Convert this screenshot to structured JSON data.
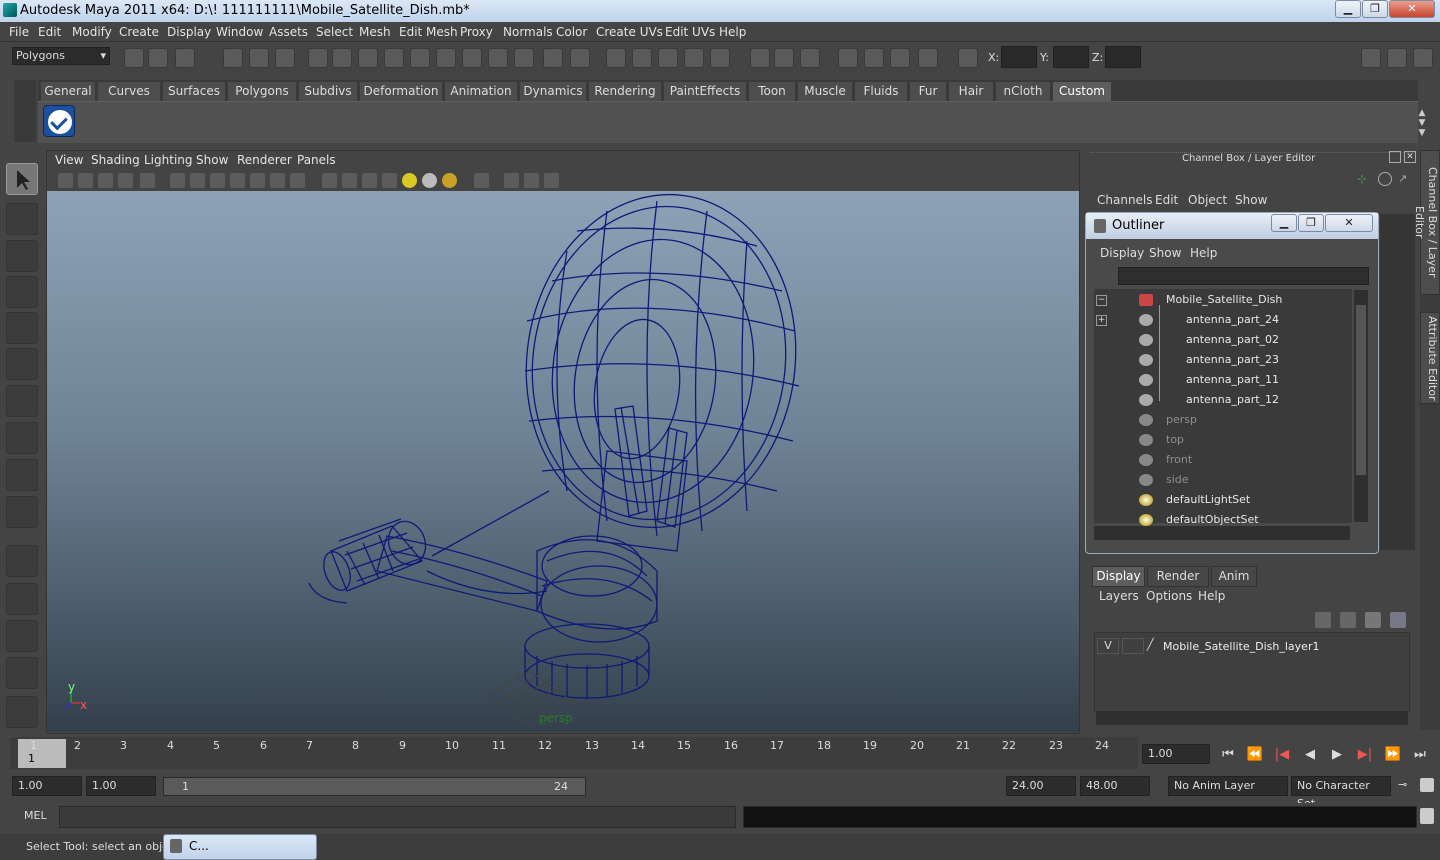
{
  "window": {
    "title": "Autodesk Maya 2011 x64: D:\\! 111111111\\Mobile_Satellite_Dish.mb*",
    "min": "▁",
    "max": "❐",
    "close": "✕"
  },
  "menu": [
    "File",
    "Edit",
    "Modify",
    "Create",
    "Display",
    "Window",
    "Assets",
    "Select",
    "Mesh",
    "Edit Mesh",
    "Proxy",
    "Normals",
    "Color",
    "Create UVs",
    "Edit UVs",
    "Help"
  ],
  "status": {
    "mode": "Polygons",
    "x_label": "X:",
    "y_label": "Y:",
    "z_label": "Z:"
  },
  "shelf": {
    "tabs": [
      "General",
      "Curves",
      "Surfaces",
      "Polygons",
      "Subdivs",
      "Deformation",
      "Animation",
      "Dynamics",
      "Rendering",
      "PaintEffects",
      "Toon",
      "Muscle",
      "Fluids",
      "Fur",
      "Hair",
      "nCloth",
      "Custom"
    ],
    "active": "Custom"
  },
  "viewport": {
    "menu": [
      "View",
      "Shading",
      "Lighting",
      "Show",
      "Renderer",
      "Panels"
    ],
    "camera_label": "persp",
    "axis_y": "y",
    "axis_x": "x",
    "wire_color": "#0d1a78"
  },
  "channelbox": {
    "title": "Channel Box / Layer Editor",
    "menu": [
      "Channels",
      "Edit",
      "Object",
      "Show"
    ]
  },
  "outliner": {
    "title": "Outliner",
    "menu": [
      "Display",
      "Show",
      "Help"
    ],
    "items": [
      {
        "label": "Mobile_Satellite_Dish",
        "dim": false,
        "expand": "−"
      },
      {
        "label": "antenna_part_24",
        "dim": false,
        "expand": "+"
      },
      {
        "label": "antenna_part_02",
        "dim": false,
        "expand": ""
      },
      {
        "label": "antenna_part_23",
        "dim": false,
        "expand": ""
      },
      {
        "label": "antenna_part_11",
        "dim": false,
        "expand": ""
      },
      {
        "label": "antenna_part_12",
        "dim": false,
        "expand": ""
      },
      {
        "label": "persp",
        "dim": true,
        "expand": ""
      },
      {
        "label": "top",
        "dim": true,
        "expand": ""
      },
      {
        "label": "front",
        "dim": true,
        "expand": ""
      },
      {
        "label": "side",
        "dim": true,
        "expand": ""
      },
      {
        "label": "defaultLightSet",
        "dim": false,
        "expand": ""
      },
      {
        "label": "defaultObjectSet",
        "dim": false,
        "expand": ""
      }
    ]
  },
  "layers": {
    "tabs": [
      "Display",
      "Render",
      "Anim"
    ],
    "active": "Display",
    "menu": [
      "Layers",
      "Options",
      "Help"
    ],
    "layer_visible": "V",
    "layer_name": "Mobile_Satellite_Dish_layer1"
  },
  "side_tabs": [
    "Channel Box / Layer Editor",
    "Attribute Editor"
  ],
  "timeline": {
    "ticks": [
      "1",
      "2",
      "3",
      "4",
      "5",
      "6",
      "7",
      "8",
      "9",
      "10",
      "11",
      "12",
      "13",
      "14",
      "15",
      "16",
      "17",
      "18",
      "19",
      "20",
      "21",
      "22",
      "23",
      "24"
    ],
    "current_frame": "1",
    "current_time": "1.00"
  },
  "playback": [
    "⏮",
    "⏪",
    "|◀",
    "◀",
    "▶",
    "▶|",
    "⏩",
    "⏭"
  ],
  "range": {
    "start": "1.00",
    "inner_start": "1.00",
    "slider_start": "1",
    "slider_end": "24",
    "end": "24.00",
    "outer_end": "48.00",
    "anim_layer": "No Anim Layer",
    "char_set": "No Character Set"
  },
  "command": {
    "label": "MEL"
  },
  "help": {
    "text": "Select Tool: select an object",
    "mini_window": "C..."
  }
}
